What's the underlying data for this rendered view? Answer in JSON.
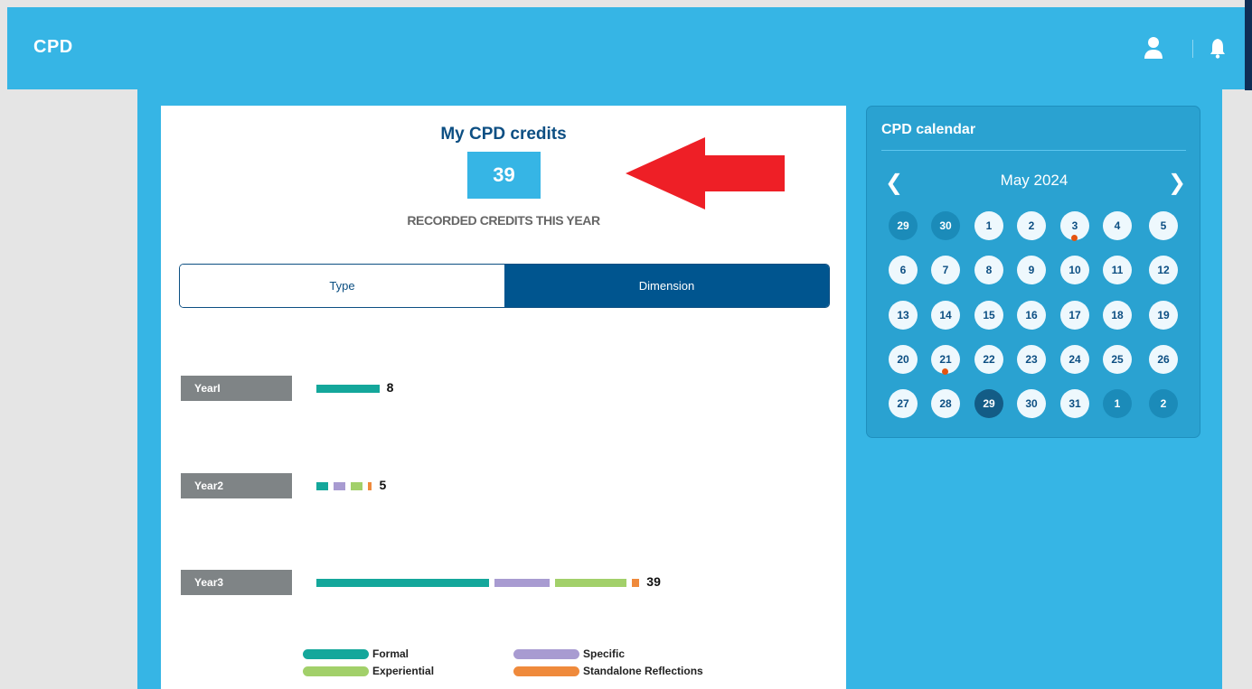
{
  "header": {
    "brand": "CPD",
    "user_icon": "user-icon",
    "bell_icon": "bell-icon"
  },
  "credits": {
    "title": "My CPD credits",
    "value": "39",
    "subtitle": "RECORDED CREDITS THIS YEAR"
  },
  "tabs": [
    {
      "label": "Type",
      "active": false
    },
    {
      "label": "Dimension",
      "active": true
    }
  ],
  "chart_data": {
    "type": "bar",
    "orientation": "horizontal",
    "stacked": true,
    "categories": [
      "Year1",
      "Year2",
      "Year3"
    ],
    "category_labels": [
      "YearI",
      "Year2",
      "Year3"
    ],
    "series": [
      {
        "name": "Formal",
        "color": "#14a79b",
        "values": [
          8,
          1.5,
          22
        ]
      },
      {
        "name": "Specific",
        "color": "#a89bd1",
        "values": [
          0,
          1.5,
          7
        ]
      },
      {
        "name": "Experiential",
        "color": "#a2d06a",
        "values": [
          0,
          1.5,
          9
        ]
      },
      {
        "name": "Standalone Reflections",
        "color": "#ef8a3c",
        "values": [
          0,
          0.5,
          1
        ]
      }
    ],
    "totals": [
      8,
      5,
      39
    ],
    "legend_position": "bottom"
  },
  "legend": [
    {
      "label": "Formal",
      "color": "#14a79b"
    },
    {
      "label": "Specific",
      "color": "#a89bd1"
    },
    {
      "label": "Experiential",
      "color": "#a2d06a"
    },
    {
      "label": "Standalone Reflections",
      "color": "#ef8a3c"
    }
  ],
  "calendar": {
    "title": "CPD calendar",
    "month": "May 2024",
    "prev_icon": "chevron-left-icon",
    "next_icon": "chevron-right-icon",
    "weeks": [
      [
        {
          "d": "29",
          "t": "other"
        },
        {
          "d": "30",
          "t": "other"
        },
        {
          "d": "1",
          "t": "cur"
        },
        {
          "d": "2",
          "t": "cur"
        },
        {
          "d": "3",
          "t": "cur",
          "event": true
        },
        {
          "d": "4",
          "t": "cur"
        },
        {
          "d": "5",
          "t": "cur"
        }
      ],
      [
        {
          "d": "6",
          "t": "cur"
        },
        {
          "d": "7",
          "t": "cur"
        },
        {
          "d": "8",
          "t": "cur"
        },
        {
          "d": "9",
          "t": "cur"
        },
        {
          "d": "10",
          "t": "cur"
        },
        {
          "d": "11",
          "t": "cur"
        },
        {
          "d": "12",
          "t": "cur"
        }
      ],
      [
        {
          "d": "13",
          "t": "cur"
        },
        {
          "d": "14",
          "t": "cur"
        },
        {
          "d": "15",
          "t": "cur"
        },
        {
          "d": "16",
          "t": "cur"
        },
        {
          "d": "17",
          "t": "cur"
        },
        {
          "d": "18",
          "t": "cur"
        },
        {
          "d": "19",
          "t": "cur"
        }
      ],
      [
        {
          "d": "20",
          "t": "cur"
        },
        {
          "d": "21",
          "t": "cur",
          "event": true
        },
        {
          "d": "22",
          "t": "cur"
        },
        {
          "d": "23",
          "t": "cur"
        },
        {
          "d": "24",
          "t": "cur"
        },
        {
          "d": "25",
          "t": "cur"
        },
        {
          "d": "26",
          "t": "cur"
        }
      ],
      [
        {
          "d": "27",
          "t": "cur"
        },
        {
          "d": "28",
          "t": "cur"
        },
        {
          "d": "29",
          "t": "today"
        },
        {
          "d": "30",
          "t": "cur"
        },
        {
          "d": "31",
          "t": "cur"
        },
        {
          "d": "1",
          "t": "other"
        },
        {
          "d": "2",
          "t": "other"
        }
      ]
    ]
  }
}
